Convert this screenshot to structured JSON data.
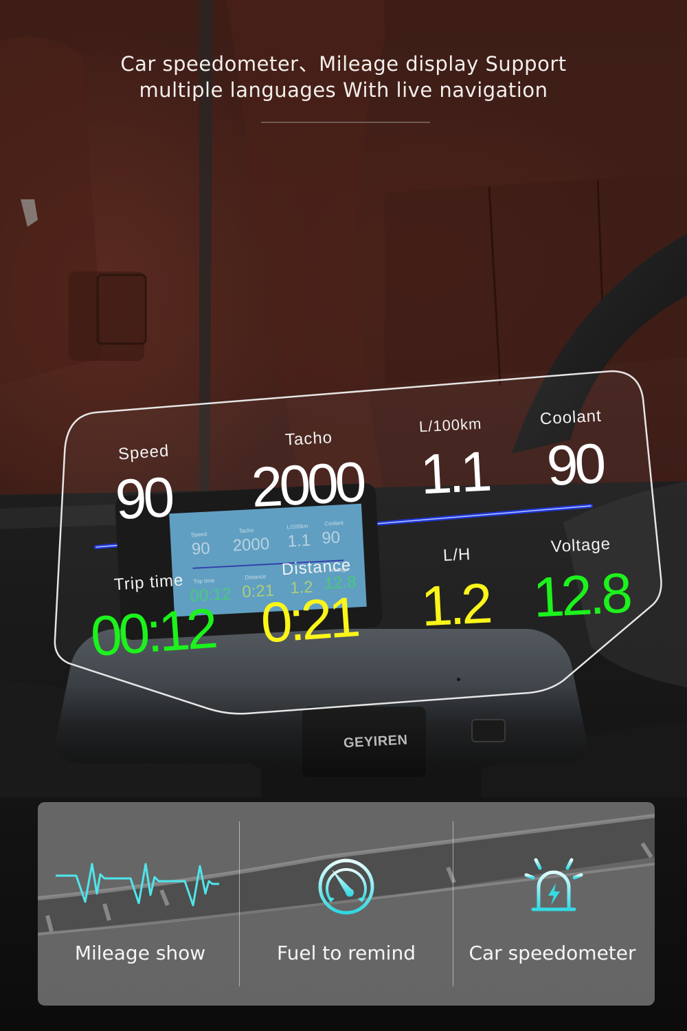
{
  "headline": {
    "line1": "Car speedometer、Mileage display Support",
    "line2": "multiple languages With live navigation"
  },
  "hud": {
    "top_row": [
      {
        "label": "Speed",
        "value": "90",
        "color": "#ffffff"
      },
      {
        "label": "Tacho",
        "value": "2000",
        "color": "#ffffff"
      },
      {
        "label": "L/100km",
        "value": "1.1",
        "color": "#ffffff"
      },
      {
        "label": "Coolant",
        "value": "90",
        "color": "#ffffff"
      }
    ],
    "bottom_row": [
      {
        "label": "Trip time",
        "value": "00:12",
        "color": "#1cf21c"
      },
      {
        "label": "Distance",
        "value": "0:21",
        "color": "#fbf51a"
      },
      {
        "label": "L/H",
        "value": "1.2",
        "color": "#fbf51a"
      },
      {
        "label": "Voltage",
        "value": "12.8",
        "color": "#1cf21c"
      }
    ]
  },
  "device": {
    "brand": "GEYIREN",
    "screen": {
      "top_labels": [
        "Speed",
        "Tacho",
        "L/100km",
        "Coolant"
      ],
      "top_values": [
        "90",
        "2000",
        "1.1",
        "90"
      ],
      "bottom_labels": [
        "Trip time",
        "Distance",
        "L/H",
        "Voltage"
      ],
      "bottom_values": [
        "00:12",
        "0:21",
        "1.2",
        "12.8"
      ]
    }
  },
  "features": [
    {
      "label": "Mileage show",
      "icon": "heartbeat-wave-icon"
    },
    {
      "label": "Fuel to remind",
      "icon": "gauge-icon"
    },
    {
      "label": "Car speedometer",
      "icon": "siren-light-icon"
    }
  ],
  "colors": {
    "accent_cyan": "#4fe6ec",
    "hud_green": "#1cf21c",
    "hud_yellow": "#fbf51a",
    "leather": "#4a2219"
  }
}
